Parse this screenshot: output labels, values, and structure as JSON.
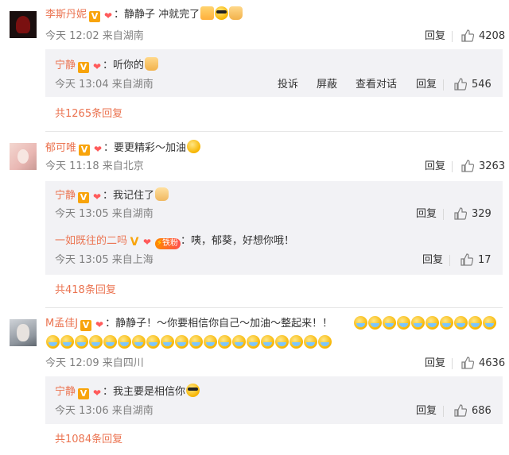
{
  "comments": [
    {
      "user": "李斯丹妮",
      "text": "：静静子 冲就完了",
      "time": "今天 12:02 来自湖南",
      "reply_label": "回复",
      "likes": "4208",
      "replies": [
        {
          "user": "宁静",
          "text": "：听你的",
          "time": "今天 13:04 来自湖南",
          "actions": [
            "投诉",
            "屏蔽",
            "查看对话"
          ],
          "reply_label": "回复",
          "likes": "546"
        }
      ],
      "more": "共1265条回复"
    },
    {
      "user": "郁可唯",
      "text": "：要更精彩～加油",
      "time": "今天 11:18 来自北京",
      "reply_label": "回复",
      "likes": "3263",
      "replies": [
        {
          "user": "宁静",
          "text": "：我记住了",
          "time": "今天 13:05 来自湖南",
          "reply_label": "回复",
          "likes": "329"
        },
        {
          "user": "一如既往的二吗",
          "fan_badge": "铁粉",
          "text": "：咦，郁葵，好想你哦！",
          "time": "今天 13:05 来自上海",
          "reply_label": "回复",
          "likes": "17"
        }
      ],
      "more": "共418条回复"
    },
    {
      "user": "M孟佳J",
      "text": "：静静子！～你要相信你自己～加油～整起来！！",
      "time": "今天 12:09 来自四川",
      "reply_label": "回复",
      "likes": "4636",
      "replies": [
        {
          "user": "宁静",
          "text": "：我主要是相信你",
          "time": "今天 13:06 来自湖南",
          "reply_label": "回复",
          "likes": "686"
        }
      ],
      "more": "共1084条回复"
    }
  ],
  "badges": {
    "verified": "V"
  },
  "colors": {
    "username": "#eb7350",
    "meta": "#808080",
    "reply_bg": "#f2f2f5",
    "badge": "#f8a40b"
  },
  "icons": [
    "verified-badge-icon",
    "vip-icon",
    "like-thumb-icon",
    "emoji-icon"
  ]
}
